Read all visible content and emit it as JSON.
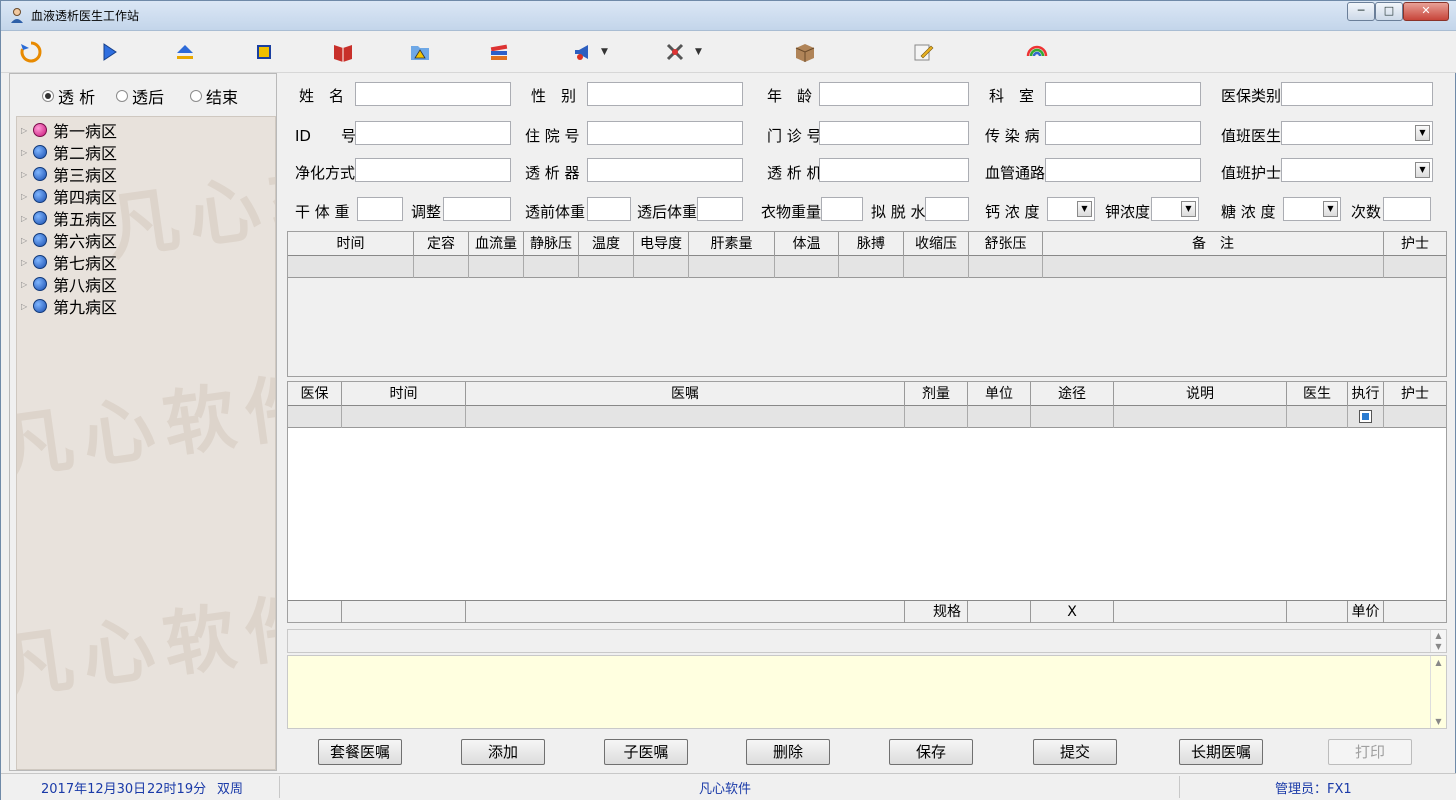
{
  "window": {
    "title": "血液透析医生工作站",
    "min": "─",
    "max": "□",
    "close": "✕"
  },
  "toolbar": [
    {
      "icon": "refresh-icon"
    },
    {
      "icon": "play-icon"
    },
    {
      "icon": "eject-icon"
    },
    {
      "icon": "stop-icon"
    },
    {
      "icon": "book-icon"
    },
    {
      "icon": "folder-warning-icon"
    },
    {
      "icon": "books-icon"
    },
    {
      "icon": "megaphone-icon",
      "dropdown": true
    },
    {
      "icon": "tools-icon",
      "dropdown": true
    },
    {
      "icon": "box-icon"
    },
    {
      "icon": "note-pencil-icon"
    },
    {
      "icon": "rainbow-icon"
    }
  ],
  "left": {
    "radios": [
      {
        "label": "透 析",
        "checked": true
      },
      {
        "label": "透后",
        "checked": false
      },
      {
        "label": "结束",
        "checked": false
      }
    ],
    "wards": [
      "第一病区",
      "第二病区",
      "第三病区",
      "第四病区",
      "第五病区",
      "第六病区",
      "第七病区",
      "第八病区",
      "第九病区"
    ],
    "watermark": "凡心软件"
  },
  "form": {
    "name": "姓　名",
    "gender": "性　别",
    "age": "年　龄",
    "dept": "科　室",
    "insurance": "医保类别",
    "id": "ID　　号",
    "inpatient": "住 院 号",
    "outpatient": "门 诊 号",
    "infectious": "传 染 病",
    "doctor": "值班医生",
    "purify": "净化方式",
    "dialyzer": "透 析 器",
    "machine": "透 析 机",
    "vascular": "血管通路",
    "nurse": "值班护士",
    "dry_weight": "干 体 重",
    "adjust": "调整",
    "pre_weight": "透前体重",
    "post_weight": "透后体重",
    "clothes": "衣物重量",
    "ultra": "拟 脱 水",
    "calcium": "钙 浓 度",
    "potassium": "钾浓度",
    "glucose": "糖 浓 度",
    "times": "次数"
  },
  "grid1": {
    "headers": [
      "时间",
      "定容",
      "血流量",
      "静脉压",
      "温度",
      "电导度",
      "肝素量",
      "体温",
      "脉搏",
      "收缩压",
      "舒张压",
      "备　注",
      "护士"
    ]
  },
  "grid2": {
    "headers": [
      "医保",
      "时间",
      "医嘱",
      "剂量",
      "单位",
      "途径",
      "说明",
      "医生",
      "执行",
      "护士"
    ],
    "footer": [
      "",
      "",
      "",
      "规格",
      "",
      "X",
      "",
      "",
      "单价",
      ""
    ]
  },
  "buttons": [
    "套餐医嘱",
    "添加",
    "子医嘱",
    "删除",
    "保存",
    "提交",
    "长期医嘱",
    "打印"
  ],
  "status": {
    "date": "2017年12月30日",
    "time": "22时19分",
    "week": "双周",
    "company": "凡心软件",
    "admin": "管理员：FX1"
  }
}
